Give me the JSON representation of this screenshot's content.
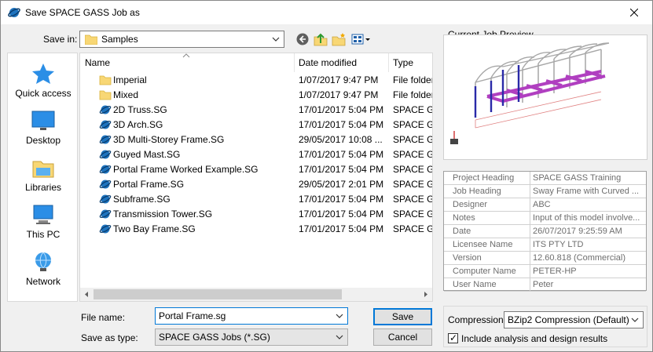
{
  "dialog": {
    "title": "Save SPACE GASS Job as",
    "save_in_label": "Save in:",
    "save_in_value": "Samples",
    "file_name_label": "File name:",
    "file_name_value": "Portal Frame.sg",
    "save_as_type_label": "Save as type:",
    "save_as_type_value": "SPACE GASS Jobs (*.SG)",
    "save_button": "Save",
    "cancel_button": "Cancel"
  },
  "places": [
    {
      "label": "Quick access",
      "icon": "quick-access-star-icon"
    },
    {
      "label": "Desktop",
      "icon": "desktop-icon"
    },
    {
      "label": "Libraries",
      "icon": "libraries-icon"
    },
    {
      "label": "This PC",
      "icon": "this-pc-icon"
    },
    {
      "label": "Network",
      "icon": "network-icon"
    }
  ],
  "columns": {
    "name": "Name",
    "date": "Date modified",
    "type": "Type"
  },
  "files": [
    {
      "name": "Imperial",
      "date": "1/07/2017 9:47 PM",
      "type": "File folder",
      "kind": "folder"
    },
    {
      "name": "Mixed",
      "date": "1/07/2017 9:47 PM",
      "type": "File folder",
      "kind": "folder"
    },
    {
      "name": "2D Truss.SG",
      "date": "17/01/2017 5:04 PM",
      "type": "SPACE GAS",
      "kind": "sg"
    },
    {
      "name": "3D Arch.SG",
      "date": "17/01/2017 5:04 PM",
      "type": "SPACE GAS",
      "kind": "sg"
    },
    {
      "name": "3D Multi-Storey Frame.SG",
      "date": "29/05/2017 10:08 ...",
      "type": "SPACE GAS",
      "kind": "sg"
    },
    {
      "name": "Guyed Mast.SG",
      "date": "17/01/2017 5:04 PM",
      "type": "SPACE GAS",
      "kind": "sg"
    },
    {
      "name": "Portal Frame Worked Example.SG",
      "date": "17/01/2017 5:04 PM",
      "type": "SPACE GAS",
      "kind": "sg"
    },
    {
      "name": "Portal Frame.SG",
      "date": "29/05/2017 2:01 PM",
      "type": "SPACE GAS",
      "kind": "sg"
    },
    {
      "name": "Subframe.SG",
      "date": "17/01/2017 5:04 PM",
      "type": "SPACE GAS",
      "kind": "sg"
    },
    {
      "name": "Transmission Tower.SG",
      "date": "17/01/2017 5:04 PM",
      "type": "SPACE GAS",
      "kind": "sg"
    },
    {
      "name": "Two Bay Frame.SG",
      "date": "17/01/2017 5:04 PM",
      "type": "SPACE GAS",
      "kind": "sg"
    }
  ],
  "preview": {
    "label": "Current Job Preview"
  },
  "properties": [
    {
      "key": "Project Heading",
      "value": "SPACE GASS Training"
    },
    {
      "key": "Job Heading",
      "value": "Sway Frame with Curved ..."
    },
    {
      "key": "Designer",
      "value": "ABC"
    },
    {
      "key": "Notes",
      "value": "Input of this model involve..."
    },
    {
      "key": "Date",
      "value": "26/07/2017 9:25:59 AM"
    },
    {
      "key": "Licensee Name",
      "value": "ITS PTY LTD"
    },
    {
      "key": "Version",
      "value": "12.60.818 (Commercial)"
    },
    {
      "key": "Computer Name",
      "value": "PETER-HP"
    },
    {
      "key": "User Name",
      "value": "Peter"
    }
  ],
  "compression": {
    "label": "Compression:",
    "value": "BZip2 Compression (Default)",
    "include_label": "Include analysis and design results",
    "include_checked": true
  },
  "colors": {
    "accent": "#0078d7",
    "folder": "#f8d775",
    "sg_icon": "#1e73be"
  }
}
